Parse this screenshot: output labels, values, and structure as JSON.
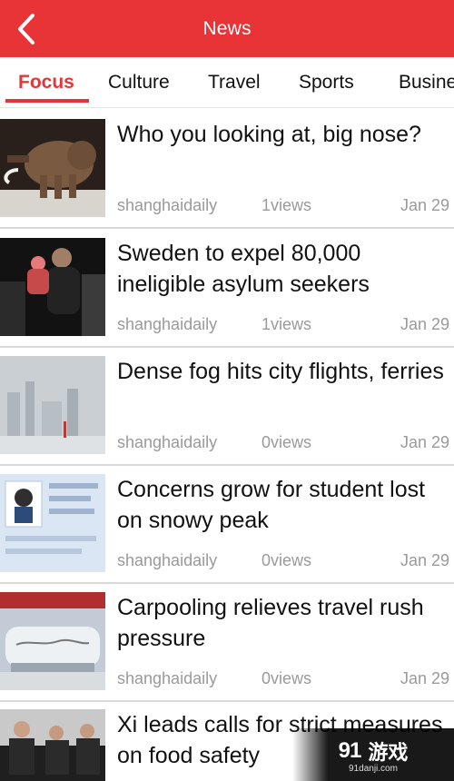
{
  "header": {
    "title": "News",
    "back_icon": "chevron-left-icon",
    "background_color": "#e83337"
  },
  "tabs": [
    {
      "label": "Focus",
      "active": true
    },
    {
      "label": "Culture",
      "active": false
    },
    {
      "label": "Travel",
      "active": false
    },
    {
      "label": "Sports",
      "active": false
    },
    {
      "label": "Busine",
      "active": false
    }
  ],
  "articles": [
    {
      "headline": "Who you looking at, big nose?",
      "source": "shanghaidaily",
      "views": "1views",
      "date": "Jan 29"
    },
    {
      "headline": "Sweden to expel 80,000 ineligible asylum seekers",
      "source": "shanghaidaily",
      "views": "1views",
      "date": "Jan 29"
    },
    {
      "headline": "Dense fog hits city flights, ferries",
      "source": "shanghaidaily",
      "views": "0views",
      "date": "Jan 29"
    },
    {
      "headline": "Concerns grow for student lost on snowy peak",
      "source": "shanghaidaily",
      "views": "0views",
      "date": "Jan 29"
    },
    {
      "headline": "Carpooling relieves travel rush pressure",
      "source": "shanghaidaily",
      "views": "0views",
      "date": "Jan 29"
    },
    {
      "headline": "Xi leads calls for strict measures on food safety",
      "source": "",
      "views": "",
      "date": ""
    }
  ],
  "watermark": {
    "brand_number": "91",
    "brand_text": "游戏",
    "url": "91danji.com"
  }
}
